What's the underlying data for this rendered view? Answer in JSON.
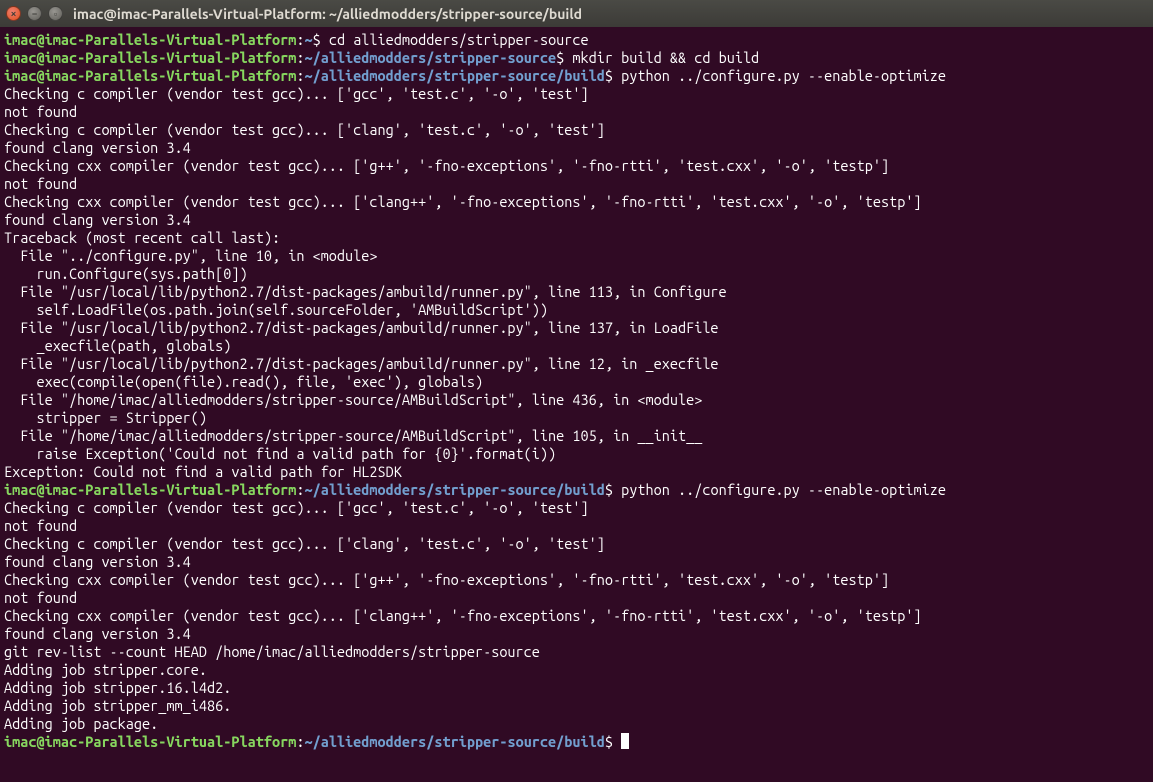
{
  "window": {
    "title": "imac@imac-Parallels-Virtual-Platform: ~/alliedmodders/stripper-source/build"
  },
  "prompt": {
    "userhost": "imac@imac-Parallels-Virtual-Platform",
    "path_home": "~",
    "path_src": "~/alliedmodders/stripper-source",
    "path_build": "~/alliedmodders/stripper-source/build",
    "dollar": "$"
  },
  "lines": [
    {
      "type": "prompt",
      "path": "path_home",
      "cmd": "cd alliedmodders/stripper-source"
    },
    {
      "type": "prompt",
      "path": "path_src",
      "cmd": "mkdir build && cd build"
    },
    {
      "type": "prompt",
      "path": "path_build",
      "cmd": "python ../configure.py --enable-optimize"
    },
    {
      "type": "out",
      "text": "Checking c compiler (vendor test gcc)... ['gcc', 'test.c', '-o', 'test']"
    },
    {
      "type": "out",
      "text": "not found"
    },
    {
      "type": "out",
      "text": "Checking c compiler (vendor test gcc)... ['clang', 'test.c', '-o', 'test']"
    },
    {
      "type": "out",
      "text": "found clang version 3.4"
    },
    {
      "type": "out",
      "text": "Checking cxx compiler (vendor test gcc)... ['g++', '-fno-exceptions', '-fno-rtti', 'test.cxx', '-o', 'testp']"
    },
    {
      "type": "out",
      "text": "not found"
    },
    {
      "type": "out",
      "text": "Checking cxx compiler (vendor test gcc)... ['clang++', '-fno-exceptions', '-fno-rtti', 'test.cxx', '-o', 'testp']"
    },
    {
      "type": "out",
      "text": "found clang version 3.4"
    },
    {
      "type": "out",
      "text": "Traceback (most recent call last):"
    },
    {
      "type": "out",
      "text": "  File \"../configure.py\", line 10, in <module>"
    },
    {
      "type": "out",
      "text": "    run.Configure(sys.path[0])"
    },
    {
      "type": "out",
      "text": "  File \"/usr/local/lib/python2.7/dist-packages/ambuild/runner.py\", line 113, in Configure"
    },
    {
      "type": "out",
      "text": "    self.LoadFile(os.path.join(self.sourceFolder, 'AMBuildScript'))"
    },
    {
      "type": "out",
      "text": "  File \"/usr/local/lib/python2.7/dist-packages/ambuild/runner.py\", line 137, in LoadFile"
    },
    {
      "type": "out",
      "text": "    _execfile(path, globals)"
    },
    {
      "type": "out",
      "text": "  File \"/usr/local/lib/python2.7/dist-packages/ambuild/runner.py\", line 12, in _execfile"
    },
    {
      "type": "out",
      "text": "    exec(compile(open(file).read(), file, 'exec'), globals)"
    },
    {
      "type": "out",
      "text": "  File \"/home/imac/alliedmodders/stripper-source/AMBuildScript\", line 436, in <module>"
    },
    {
      "type": "out",
      "text": "    stripper = Stripper()"
    },
    {
      "type": "out",
      "text": "  File \"/home/imac/alliedmodders/stripper-source/AMBuildScript\", line 105, in __init__"
    },
    {
      "type": "out",
      "text": "    raise Exception('Could not find a valid path for {0}'.format(i))"
    },
    {
      "type": "out",
      "text": "Exception: Could not find a valid path for HL2SDK"
    },
    {
      "type": "prompt",
      "path": "path_build",
      "cmd": "python ../configure.py --enable-optimize"
    },
    {
      "type": "out",
      "text": "Checking c compiler (vendor test gcc)... ['gcc', 'test.c', '-o', 'test']"
    },
    {
      "type": "out",
      "text": "not found"
    },
    {
      "type": "out",
      "text": "Checking c compiler (vendor test gcc)... ['clang', 'test.c', '-o', 'test']"
    },
    {
      "type": "out",
      "text": "found clang version 3.4"
    },
    {
      "type": "out",
      "text": "Checking cxx compiler (vendor test gcc)... ['g++', '-fno-exceptions', '-fno-rtti', 'test.cxx', '-o', 'testp']"
    },
    {
      "type": "out",
      "text": "not found"
    },
    {
      "type": "out",
      "text": "Checking cxx compiler (vendor test gcc)... ['clang++', '-fno-exceptions', '-fno-rtti', 'test.cxx', '-o', 'testp']"
    },
    {
      "type": "out",
      "text": "found clang version 3.4"
    },
    {
      "type": "out",
      "text": "git rev-list --count HEAD /home/imac/alliedmodders/stripper-source"
    },
    {
      "type": "out",
      "text": "Adding job stripper.core."
    },
    {
      "type": "out",
      "text": "Adding job stripper.16.l4d2."
    },
    {
      "type": "out",
      "text": "Adding job stripper_mm_i486."
    },
    {
      "type": "out",
      "text": "Adding job package."
    },
    {
      "type": "prompt",
      "path": "path_build",
      "cmd": "",
      "cursor": true
    }
  ]
}
